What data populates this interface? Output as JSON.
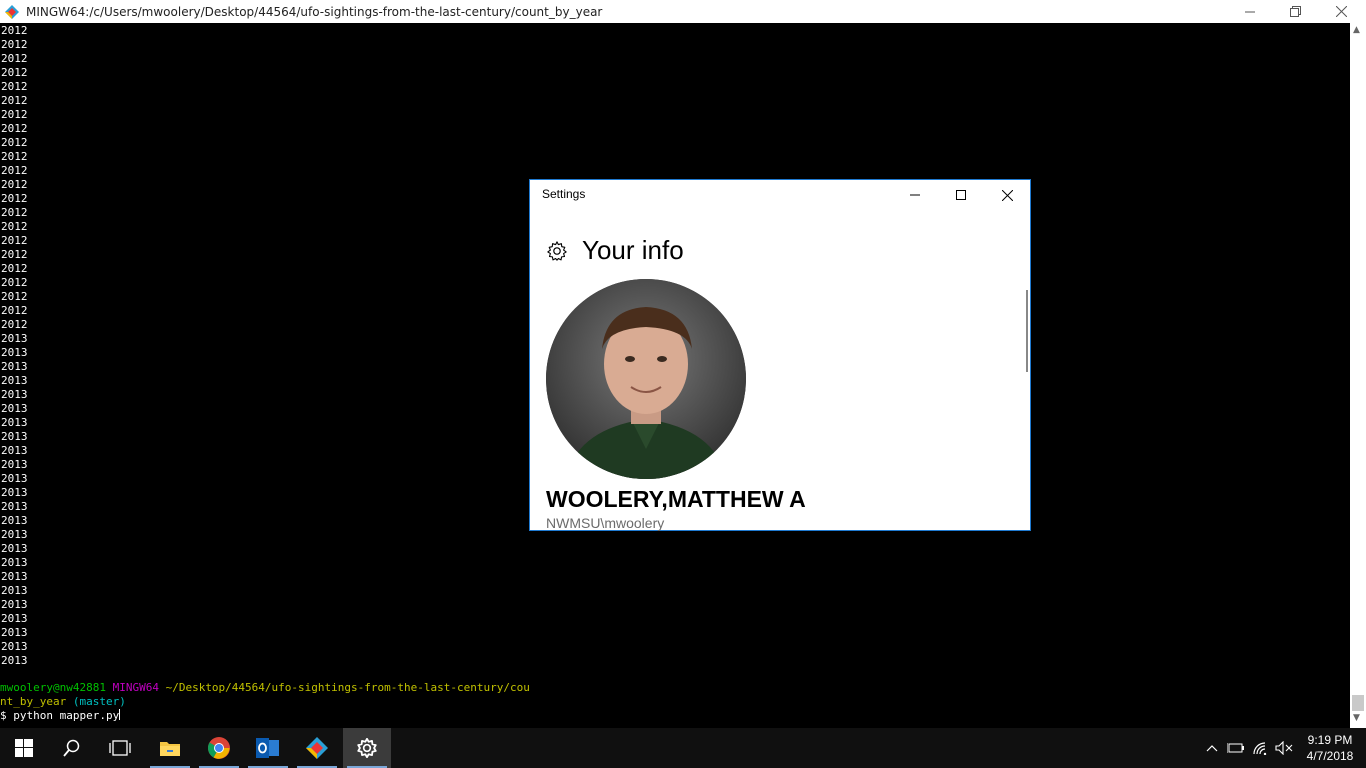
{
  "terminal": {
    "title": "MINGW64:/c/Users/mwoolery/Desktop/44564/ufo-sightings-from-the-last-century/count_by_year",
    "lines": [
      "2012",
      "2012",
      "2012",
      "2012",
      "2012",
      "2012",
      "2012",
      "2012",
      "2012",
      "2012",
      "2012",
      "2012",
      "2012",
      "2012",
      "2012",
      "2012",
      "2012",
      "2012",
      "2012",
      "2012",
      "2012",
      "2012",
      "2013",
      "2013",
      "2013",
      "2013",
      "2013",
      "2013",
      "2013",
      "2013",
      "2013",
      "2013",
      "2013",
      "2013",
      "2013",
      "2013",
      "2013",
      "2013",
      "2013",
      "2013",
      "2013",
      "2013",
      "2013",
      "2013",
      "2013",
      "2013"
    ],
    "prompt": {
      "user_host": "mwoolery@nw42881",
      "shell": "MINGW64",
      "path_part1": "~/Desktop/44564/ufo-sightings-from-the-last-century/cou",
      "path_part2": "nt_by_year",
      "branch": "(master)",
      "command": "$ python mapper.py"
    }
  },
  "settings": {
    "window_title": "Settings",
    "heading": "Your info",
    "user_name": "WOOLERY,MATTHEW A",
    "account": "NWMSU\\mwoolery"
  },
  "taskbar": {
    "time": "9:19 PM",
    "date": "4/7/2018",
    "apps": [
      "start-icon",
      "search-icon",
      "task-view-icon",
      "file-explorer-icon",
      "chrome-icon",
      "outlook-icon",
      "git-bash-icon",
      "settings-icon"
    ]
  }
}
